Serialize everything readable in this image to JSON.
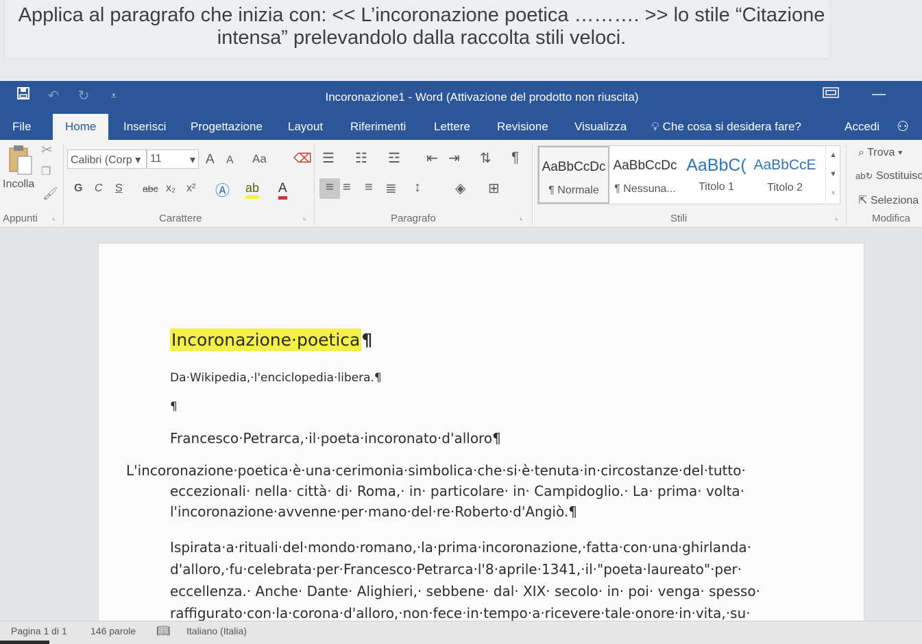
{
  "instruction": {
    "line1": "Applica al paragrafo che inizia con: << L’incoronazione poetica ………. >> lo stile “Citazione",
    "line2": "intensa” prelevandolo dalla raccolta stili veloci."
  },
  "titlebar": {
    "title": "Incoronazione1 - Word (Attivazione del prodotto non riuscita)"
  },
  "tabs": {
    "file": "File",
    "home": "Home",
    "inserisci": "Inserisci",
    "progettazione": "Progettazione",
    "layout": "Layout",
    "riferimenti": "Riferimenti",
    "lettere": "Lettere",
    "revisione": "Revisione",
    "visualizza": "Visualizza",
    "tell_me": "Che cosa si desidera fare?",
    "accedi": "Accedi"
  },
  "ribbon": {
    "clipboard": {
      "paste_label": "Incolla",
      "group": "Appunti"
    },
    "font": {
      "family": "Calibri (Corp",
      "size": "11",
      "bold": "G",
      "italic": "C",
      "underline": "S",
      "strike": "abc",
      "subscript": "x₂",
      "superscript": "x²",
      "case": "Aa",
      "grow": "A",
      "shrink": "A",
      "group": "Carattere"
    },
    "paragraph": {
      "group": "Paragrafo",
      "pilcrow": "¶"
    },
    "styles": {
      "group": "Stili",
      "items": [
        {
          "preview": "AaBbCcDc",
          "name": "¶ Normale"
        },
        {
          "preview": "AaBbCcDc",
          "name": "¶ Nessuna..."
        },
        {
          "preview": "AaBbC(",
          "name": "Titolo 1"
        },
        {
          "preview": "AaBbCcE",
          "name": "Titolo 2"
        }
      ]
    },
    "editing": {
      "group": "Modifica",
      "find": "Trova",
      "replace": "Sostituisci",
      "select": "Seleziona"
    }
  },
  "document": {
    "title": "Incoronazione·poetica",
    "title_mark": "¶",
    "subtitle": "Da·Wikipedia,·l'enciclopedia·libera.¶",
    "empty": "¶",
    "heading": "Francesco·Petrarca,·il·poeta·incoronato·d'alloro¶",
    "p1": {
      "l1": "L'incoronazione·poetica·è·una·cerimonia·simbolica·che·si·è·tenuta·in·circostanze·del·tutto·",
      "l2": "eccezionali· nella· città· di· Roma,· in· particolare· in· Campidoglio.· La· prima· volta·",
      "l3": "l'incoronazione·avvenne·per·mano·del·re·Roberto·d'Angiò.¶"
    },
    "p2": {
      "l1": "Ispirata·a·rituali·del·mondo·romano,·la·prima·incoronazione,·fatta·con·una·ghirlanda·",
      "l2": "d'alloro,·fu·celebrata·per·Francesco·Petrarca·l'8·aprile·1341,·il·\"poeta·laureato\"·per·",
      "l3": "eccellenza.· Anche· Dante· Alighieri,· sebbene· dal· XIX· secolo· in· poi· venga· spesso·",
      "l4": "raffigurato·con·la·corona·d'alloro,·non·fece·in·tempo·a·ricevere·tale·onore·in·vita,·su·"
    }
  },
  "status": {
    "page": "Pagina 1 di 1",
    "words": "146 parole",
    "language": "Italiano (Italia)"
  },
  "colors": {
    "word_blue": "#2b579a",
    "highlight": "#f3f04a"
  }
}
